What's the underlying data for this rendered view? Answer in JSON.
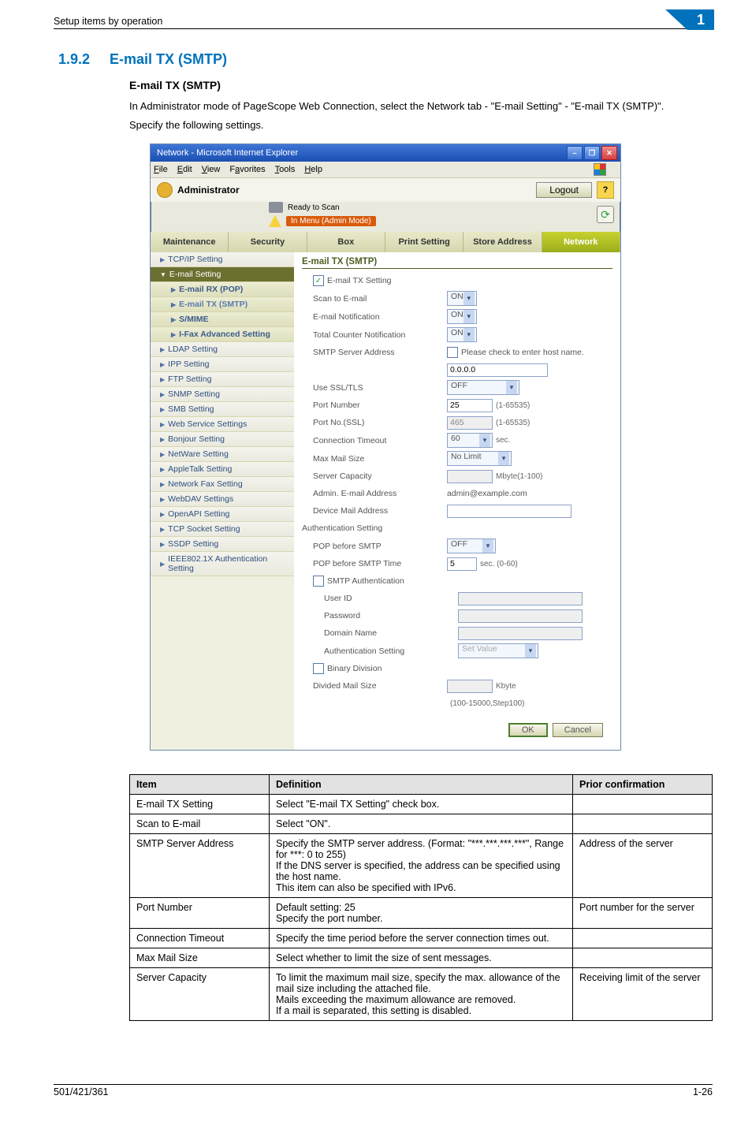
{
  "page": {
    "breadcrumb": "Setup items by operation",
    "chapter_badge": "1",
    "section_number": "1.9.2",
    "section_title": "E-mail TX (SMTP)",
    "subtitle": "E-mail TX (SMTP)",
    "para1": "In Administrator mode of PageScope Web Connection, select the Network tab - \"E-mail Setting\" - \"E-mail TX (SMTP)\".",
    "para2": "Specify the following settings.",
    "footer_left": "501/421/361",
    "footer_right": "1-26"
  },
  "browser": {
    "title": "Network - Microsoft Internet Explorer",
    "win_min": "–",
    "win_max": "❐",
    "win_close": "✕",
    "menu": {
      "file": "File",
      "edit": "Edit",
      "view": "View",
      "favorites": "Favorites",
      "tools": "Tools",
      "help": "Help"
    },
    "admin_label": "Administrator",
    "logout": "Logout",
    "help_icon": "?",
    "ready": "Ready to Scan",
    "in_menu": "In Menu (Admin Mode)",
    "reload_icon": "⟳",
    "tabs": {
      "maintenance": "Maintenance",
      "security": "Security",
      "box": "Box",
      "print": "Print Setting",
      "store": "Store Address",
      "network": "Network"
    },
    "sidebar": {
      "tcp": "TCP/IP Setting",
      "email": "E-mail Setting",
      "rx": "E-mail RX (POP)",
      "tx": "E-mail TX (SMTP)",
      "smime": "S/MIME",
      "ifax": "I-Fax Advanced Setting",
      "ldap": "LDAP Setting",
      "ipp": "IPP Setting",
      "ftp": "FTP Setting",
      "snmp": "SNMP Setting",
      "smb": "SMB Setting",
      "ws": "Web Service Settings",
      "bonjour": "Bonjour Setting",
      "netware": "NetWare Setting",
      "appletalk": "AppleTalk Setting",
      "netfax": "Network Fax Setting",
      "webdav": "WebDAV Settings",
      "openapi": "OpenAPI Setting",
      "tcpsocket": "TCP Socket Setting",
      "ssdp": "SSDP Setting",
      "ieee": "IEEE802.1X Authentication Setting"
    },
    "content": {
      "title": "E-mail TX (SMTP)",
      "check_mark": "✓",
      "email_tx_setting": "E-mail TX Setting",
      "scan_to_email": "Scan to E-mail",
      "scan_to_email_v": "ON",
      "email_notif": "E-mail Notification",
      "email_notif_v": "ON",
      "total_counter": "Total Counter Notification",
      "total_counter_v": "ON",
      "smtp_addr": "SMTP Server Address",
      "host_check": "Please check to enter host name.",
      "smtp_addr_v": "0.0.0.0",
      "use_ssl": "Use SSL/TLS",
      "use_ssl_v": "OFF",
      "port_num": "Port Number",
      "port_num_v": "25",
      "port_num_range": "(1-65535)",
      "port_ssl": "Port No.(SSL)",
      "port_ssl_v": "465",
      "port_ssl_range": "(1-65535)",
      "conn_to": "Connection Timeout",
      "conn_to_v": "60",
      "conn_to_unit": "sec.",
      "max_mail": "Max Mail Size",
      "max_mail_v": "No Limit",
      "srv_cap": "Server Capacity",
      "srv_cap_unit": "Mbyte(1-100)",
      "admin_email": "Admin. E-mail Address",
      "admin_email_v": "admin@example.com",
      "dev_mail": "Device Mail Address",
      "auth_setting": "Authentication Setting",
      "pop_before": "POP before SMTP",
      "pop_before_v": "OFF",
      "pop_time": "POP before SMTP Time",
      "pop_time_v": "5",
      "pop_time_unit": "sec. (0-60)",
      "smtp_auth": "SMTP Authentication",
      "user_id": "User ID",
      "password": "Password",
      "domain": "Domain Name",
      "auth_setting_2": "Authentication Setting",
      "auth_setting_2_v": "Set Value",
      "bin_div": "Binary Division",
      "div_mail": "Divided Mail Size",
      "div_unit": "Kbyte",
      "div_range": "(100-15000,Step100)",
      "ok": "OK",
      "cancel": "Cancel"
    }
  },
  "deftable": {
    "h_item": "Item",
    "h_def": "Definition",
    "h_prior": "Prior confirmation",
    "rows": [
      {
        "item": "E-mail TX Setting",
        "def": "Select \"E-mail TX Setting\" check box.",
        "prior": ""
      },
      {
        "item": "Scan to E-mail",
        "def": "Select \"ON\".",
        "prior": ""
      },
      {
        "item": "SMTP Server Address",
        "def": "Specify the SMTP server address. (Format: \"***.***.***.***\", Range for ***: 0 to 255)\nIf the DNS server is specified, the address can be specified using the host name.\nThis item can also be specified with IPv6.",
        "prior": "Address of the server"
      },
      {
        "item": "Port Number",
        "def": "Default setting: 25\nSpecify the port number.",
        "prior": "Port number for the server"
      },
      {
        "item": "Connection Timeout",
        "def": "Specify the time period before the server connection times out.",
        "prior": ""
      },
      {
        "item": "Max Mail Size",
        "def": "Select whether to limit the size of sent messages.",
        "prior": ""
      },
      {
        "item": "Server Capacity",
        "def": "To limit the maximum mail size, specify the max. allowance of the mail size including the attached file.\nMails exceeding the maximum allowance are removed.\nIf a mail is separated, this setting is disabled.",
        "prior": "Receiving limit of the server"
      }
    ]
  }
}
